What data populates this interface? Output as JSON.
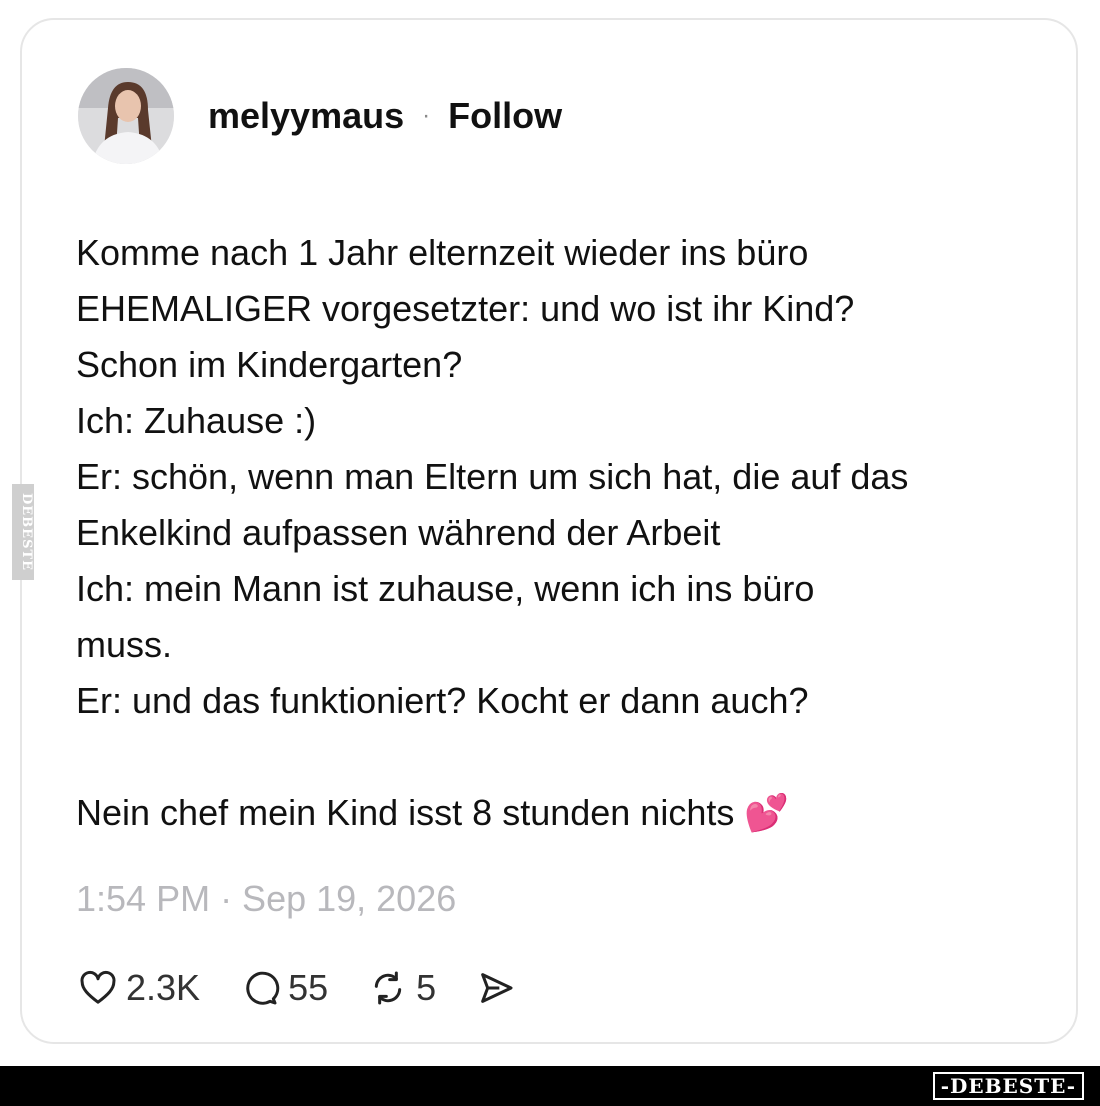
{
  "profile": {
    "username": "melyymaus",
    "separator": "·",
    "follow_label": "Follow"
  },
  "post": {
    "lines": [
      "Komme nach 1 Jahr elternzeit wieder ins büro",
      "EHEMALIGER vorgesetzter: und wo ist ihr Kind?",
      "Schon im Kindergarten?",
      "Ich: Zuhause :)",
      "Er: schön, wenn man Eltern um sich hat, die auf das",
      "Enkelkind aufpassen während der Arbeit",
      "Ich: mein Mann ist zuhause, wenn ich ins büro",
      "muss.",
      "Er: und das funktioniert? Kocht er dann auch?"
    ],
    "final_line": "Nein chef mein Kind isst 8 stunden nichts",
    "emoji": "💕"
  },
  "meta": {
    "timestamp": "1:54 PM · Sep 19, 2026"
  },
  "actions": {
    "likes": "2.3K",
    "comments": "55",
    "reposts": "5"
  },
  "icons": [
    "heart-icon",
    "comment-icon",
    "repost-icon",
    "share-icon"
  ],
  "watermark": {
    "side_text": "DEBESTE",
    "bottom_text": "-DEBESTE-"
  },
  "colors": {
    "timestamp": "#b8b8bc",
    "border": "#e6e6e6"
  }
}
